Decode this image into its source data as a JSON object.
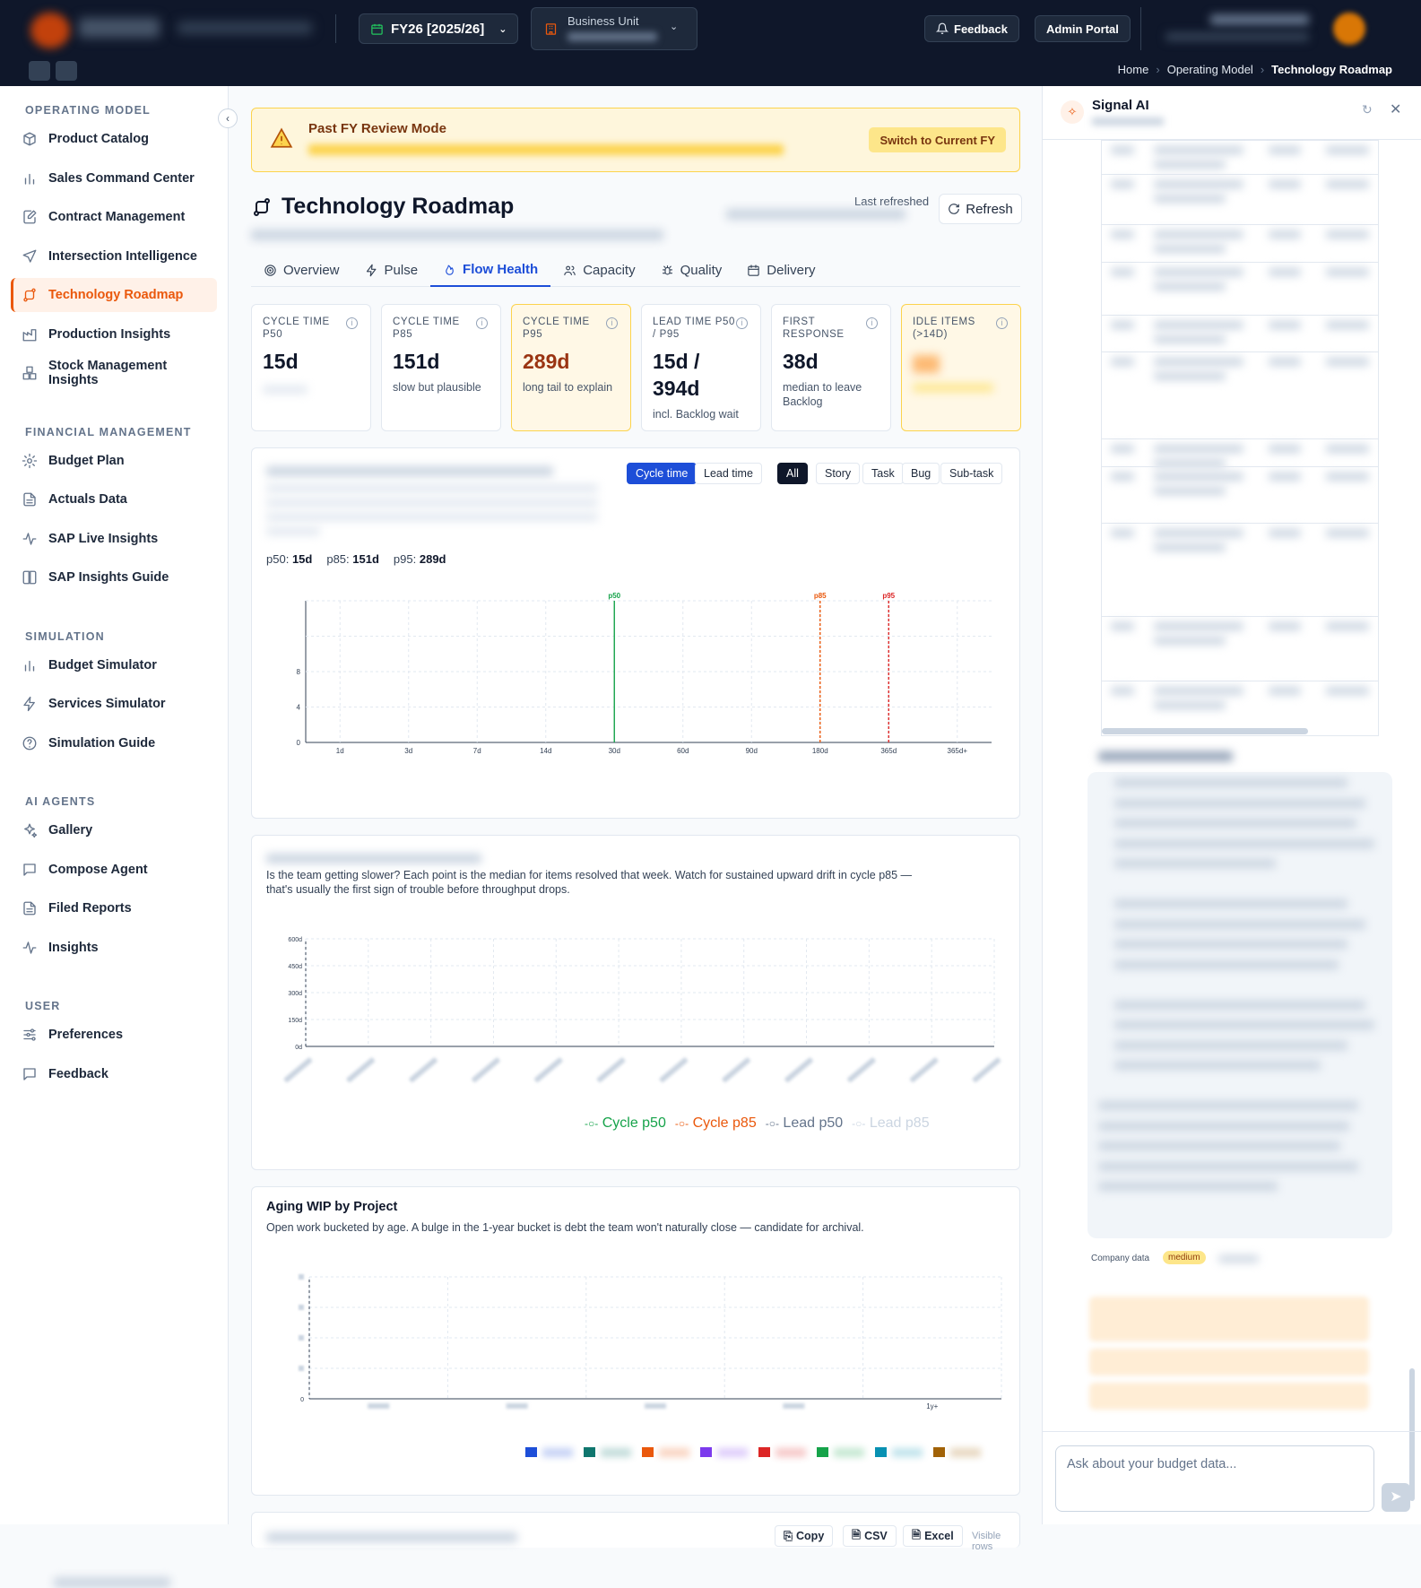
{
  "header": {
    "fy_label": "FY26 [2025/26]",
    "business_unit_label": "Business Unit",
    "feedback_label": "Feedback",
    "admin_label": "Admin Portal",
    "breadcrumb": [
      "Home",
      "Operating Model",
      "Technology Roadmap"
    ]
  },
  "sidebar": {
    "sections": [
      {
        "title": "OPERATING MODEL",
        "items": [
          {
            "label": "Product Catalog",
            "icon": "box-icon"
          },
          {
            "label": "Sales Command Center",
            "icon": "bar-chart-icon"
          },
          {
            "label": "Contract Management",
            "icon": "edit-document-icon"
          },
          {
            "label": "Intersection Intelligence",
            "icon": "send-icon"
          },
          {
            "label": "Technology Roadmap",
            "icon": "route-icon",
            "active": true
          },
          {
            "label": "Production Insights",
            "icon": "factory-icon"
          },
          {
            "label": "Stock Management Insights",
            "icon": "boxes-icon"
          }
        ]
      },
      {
        "title": "FINANCIAL MANAGEMENT",
        "items": [
          {
            "label": "Budget Plan",
            "icon": "gear-icon"
          },
          {
            "label": "Actuals Data",
            "icon": "document-icon"
          },
          {
            "label": "SAP Live Insights",
            "icon": "activity-icon"
          },
          {
            "label": "SAP Insights Guide",
            "icon": "book-icon"
          }
        ]
      },
      {
        "title": "SIMULATION",
        "items": [
          {
            "label": "Budget Simulator",
            "icon": "bar-chart-icon"
          },
          {
            "label": "Services Simulator",
            "icon": "lightning-icon"
          },
          {
            "label": "Simulation Guide",
            "icon": "help-circle-icon"
          }
        ]
      },
      {
        "title": "AI AGENTS",
        "items": [
          {
            "label": "Gallery",
            "icon": "sparkles-icon"
          },
          {
            "label": "Compose Agent",
            "icon": "message-icon"
          },
          {
            "label": "Filed Reports",
            "icon": "document-icon"
          },
          {
            "label": "Insights",
            "icon": "activity-icon"
          }
        ]
      },
      {
        "title": "USER",
        "items": [
          {
            "label": "Preferences",
            "icon": "sliders-icon"
          },
          {
            "label": "Feedback",
            "icon": "message-icon"
          }
        ]
      }
    ]
  },
  "banner": {
    "title": "Past FY Review Mode",
    "button": "Switch to Current FY"
  },
  "page": {
    "title": "Technology Roadmap",
    "last_refreshed_label": "Last refreshed",
    "refresh_label": "Refresh"
  },
  "tabs": [
    {
      "label": "Overview",
      "icon": "target-icon"
    },
    {
      "label": "Pulse",
      "icon": "lightning-icon"
    },
    {
      "label": "Flow Health",
      "icon": "flame-icon",
      "active": true
    },
    {
      "label": "Capacity",
      "icon": "users-icon"
    },
    {
      "label": "Quality",
      "icon": "bug-icon"
    },
    {
      "label": "Delivery",
      "icon": "calendar-icon"
    }
  ],
  "kpis": [
    {
      "label": "CYCLE TIME P50",
      "value": "15d",
      "desc": ""
    },
    {
      "label": "CYCLE TIME P85",
      "value": "151d",
      "desc": "slow but plausible"
    },
    {
      "label": "CYCLE TIME P95",
      "value": "289d",
      "desc": "long tail to explain",
      "warn": true
    },
    {
      "label": "LEAD TIME P50 / P95",
      "value": "15d / 394d",
      "desc": "incl. Backlog wait"
    },
    {
      "label": "FIRST RESPONSE",
      "value": "38d",
      "desc": "median to leave Backlog"
    },
    {
      "label": "IDLE ITEMS (>14D)",
      "value": "",
      "desc": "",
      "warn": true
    }
  ],
  "distribution": {
    "modes": [
      "Cycle time",
      "Lead time"
    ],
    "filters": [
      "All",
      "Story",
      "Task",
      "Bug",
      "Sub-task"
    ],
    "p50_label": "p50:",
    "p50": "15d",
    "p85_label": "p85:",
    "p85": "151d",
    "p95_label": "p95:",
    "p95": "289d"
  },
  "trend": {
    "description": "Is the team getting slower? Each point is the median for items resolved that week. Watch for sustained upward drift in cycle p85 — that's usually the first sign of trouble before throughput drops.",
    "legend": [
      "Cycle p50",
      "Cycle p85",
      "Lead p50",
      "Lead p85"
    ]
  },
  "aging": {
    "title": "Aging WIP by Project",
    "description": "Open work bucketed by age. A bulge in the 1-year bucket is debt the team won't naturally close — candidate for archival."
  },
  "bottom_card": {
    "copy": "Copy",
    "csv": "CSV",
    "excel": "Excel",
    "visible": "Visible rows"
  },
  "ai": {
    "title": "Signal AI",
    "company_data": "Company data",
    "confidence": "medium",
    "input_placeholder": "Ask about your budget data..."
  },
  "chart_data": [
    {
      "type": "bar",
      "x": [
        "1d",
        "3d",
        "7d",
        "14d",
        "30d",
        "60d",
        "90d",
        "180d",
        "365d",
        "365d+"
      ],
      "yticks": [
        0,
        4,
        8,
        null,
        null
      ],
      "annotations": [
        {
          "label": "p50",
          "at": "30d",
          "color": "#16a34a"
        },
        {
          "label": "p85",
          "at": "180d",
          "color": "#ea580c"
        },
        {
          "label": "p95",
          "at": "365d",
          "color": "#dc2626"
        }
      ]
    },
    {
      "type": "line",
      "yticks": [
        "0d",
        "150d",
        "300d",
        "450d",
        "600d"
      ],
      "ylim": [
        0,
        600
      ],
      "legend": [
        "Cycle p50",
        "Cycle p85",
        "Lead p50",
        "Lead p85"
      ],
      "colors": [
        "#16a34a",
        "#ea580c",
        "#64748b",
        "#cbd5e1"
      ]
    },
    {
      "type": "bar",
      "x_last_label": "1y+",
      "yticks": [
        0
      ],
      "legend_colors": [
        "#1d4ed8",
        "#0f766e",
        "#ea580c",
        "#7c3aed",
        "#dc2626",
        "#16a34a",
        "#0891b2",
        "#a16207"
      ]
    }
  ]
}
